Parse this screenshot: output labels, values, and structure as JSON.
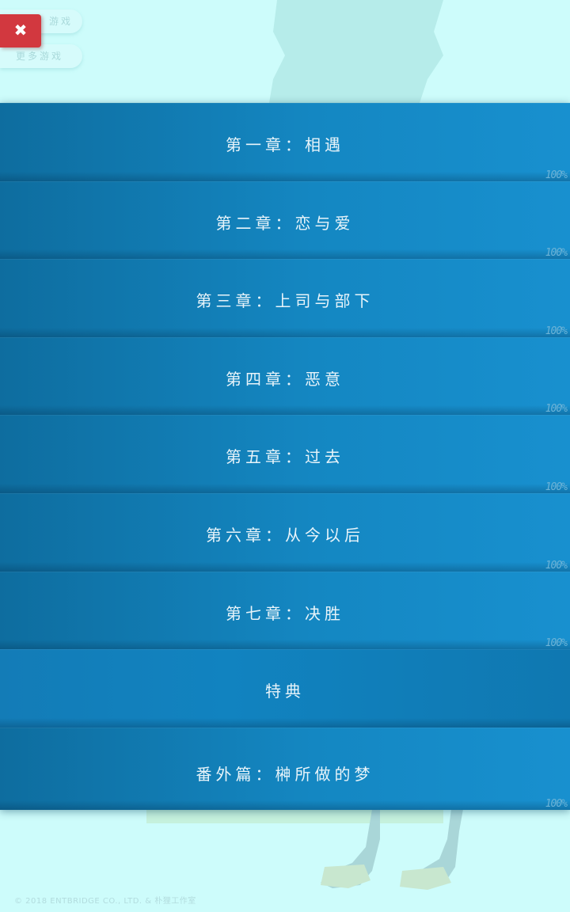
{
  "menu": {
    "pill_top_label": "游戏",
    "pill_more_label": "更多游戏",
    "close_label": "✖"
  },
  "chapters": [
    {
      "title": "第一章：相遇",
      "progress": "100%"
    },
    {
      "title": "第二章：恋与爱",
      "progress": "100%"
    },
    {
      "title": "第三章：上司与部下",
      "progress": "100%"
    },
    {
      "title": "第四章：恶意",
      "progress": "100%"
    },
    {
      "title": "第五章：过去",
      "progress": "100%"
    },
    {
      "title": "第六章：从今以后",
      "progress": "100%"
    },
    {
      "title": "第七章：决胜",
      "progress": "100%"
    },
    {
      "title": "特典"
    },
    {
      "title": "番外篇：榊所做的梦",
      "progress": "100%"
    }
  ],
  "footer": {
    "copyright": "© 2018 ENTBRIDGE CO., LTD. & 朴狸工作室"
  },
  "colors": {
    "background": "#cdfcfb",
    "chapter_bar": "#1487c2",
    "close_button": "#d2383f"
  }
}
